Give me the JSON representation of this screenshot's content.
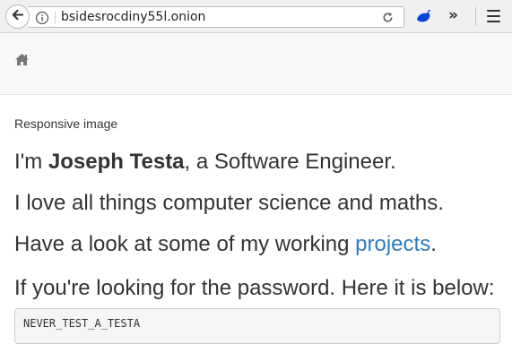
{
  "browser": {
    "url": "bsidesrocdiny55l.onion",
    "icons": {
      "back": "back-arrow-icon",
      "info": "info-icon",
      "reload": "reload-icon",
      "extension": "extension-icon",
      "overflow": "overflow-chevron-icon",
      "menu": "hamburger-menu-icon"
    },
    "overflow_glyph": "»"
  },
  "navbar": {
    "home_icon": "home-icon"
  },
  "main": {
    "image_alt": "Responsive image",
    "intro_prefix": "I'm ",
    "intro_name": "Joseph Testa",
    "intro_suffix": ", a Software Engineer.",
    "love_line": "I love all things computer science and maths.",
    "projects_prefix": "Have a look at some of my working ",
    "projects_link": "projects",
    "projects_suffix": ".",
    "password_line": "If you're looking for the password. Here it is below:",
    "password_value": "NEVER_TEST_A_TESTA"
  },
  "colors": {
    "link": "#337ab7",
    "text": "#333333",
    "navbar_bg": "#f8f8f8",
    "extension_icon": "#0a46d6"
  }
}
